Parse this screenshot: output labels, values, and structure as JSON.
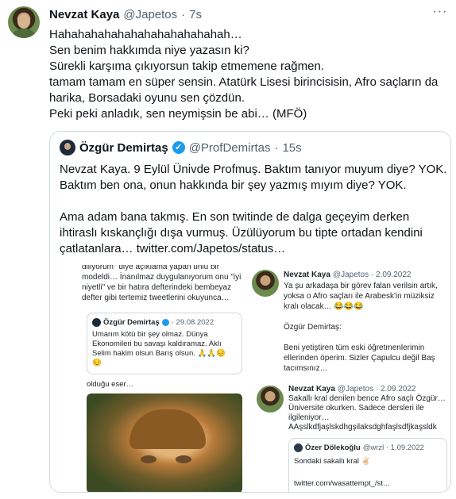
{
  "tweet": {
    "author_name": "Nevzat Kaya",
    "author_handle": "@Japetos",
    "dot": "·",
    "time": "7s",
    "more_label": "···",
    "lines": [
      "Hahahahahahahahahahahahahah…",
      "Sen benim hakkımda niye yazasın ki?",
      "Sürekli karşıma çıkıyorsun takip etmemene rağmen.",
      "tamam tamam en süper sensin. Atatürk Lisesi birincisisin, Afro saçların da",
      "harika, Borsadaki oyunu sen çözdün.",
      "Peki peki anladık, sen neymişsin be abi… (MFÖ)"
    ]
  },
  "quote": {
    "author_name": "Özgür Demirtaş",
    "verified_mark": "✓",
    "author_handle": "@ProfDemirtas",
    "dot": "·",
    "time": "15s",
    "para1": [
      "Nevzat Kaya. 9 Eylül Ünivde Profmuş. Baktım tanıyor muyum diye? YOK.",
      "Baktım ben ona, onun hakkında bir şey yazmış mıyım diye? YOK."
    ],
    "para2": [
      "Ama adam bana takmış. En son twitinde de dalga geçeyim derken",
      "ihtiraslı kıskançlığı dışa vurmuş. Üzülüyorum bu tipte ortadan kendini",
      "çatlatanlara…  twitter.com/Japetos/status…"
    ]
  },
  "media": {
    "left": {
      "top_lines": [
        "diliyorum\" diye açıklama yapan ünlü bir",
        "modeldi… İnanılmaz duygulanıyorum onu \"iyi",
        "niyetli\" ve bir hatıra defterindeki bembeyaz",
        "defter gibi tertemiz tweetlerini okuyunca…"
      ],
      "inner_quote": {
        "name": "Özgür Demirtaş",
        "meta": "· 29.08.2022",
        "lines": [
          "Umarım kötü bir şey olmaz. Dünya",
          "Ekonomileri bu savaşı kaldıramaz. Aklı",
          "Selim hakim olsun Barış olsun. 🙏🙏😔",
          "😔"
        ]
      },
      "after_text": "olduğu eser…"
    },
    "right": {
      "tweet1": {
        "name": "Nevzat Kaya",
        "meta": "@Japetos · 2.09.2022",
        "lines": [
          "Ya şu arkadaşa bir görev falan verilsin artık,",
          "yoksa o Afro saçları ile Arabesk'in müziksiz",
          "kralı olacak… 😂😂😂"
        ],
        "lines2": [
          "Özgür Demirtaş:"
        ],
        "lines3": [
          "Beni yetiştiren tüm eski öğretmenlerimin",
          "ellerinden öperim. Sizler Çapulcu değil Baş",
          "tacımsınız…"
        ]
      },
      "tweet2": {
        "name": "Nevzat Kaya",
        "meta": "@Japetos · 2.09.2022",
        "lines": [
          "Sakallı kral denilen bence Afro saçlı Özgür…",
          "Üniversite okurken. Sadece dersleri ile",
          "ilgileniyor…",
          "AAşslkdfjaşlskdhgşilaksdghfaşlsdfjkaşsldk"
        ]
      },
      "inner": {
        "name": "Özer Dölekoğlu",
        "meta": "@wrzl · 1.09.2022",
        "text": "Sondaki sakallı kral ✌🏻",
        "link": "twitter.com/wasattempt_/st…"
      }
    }
  }
}
